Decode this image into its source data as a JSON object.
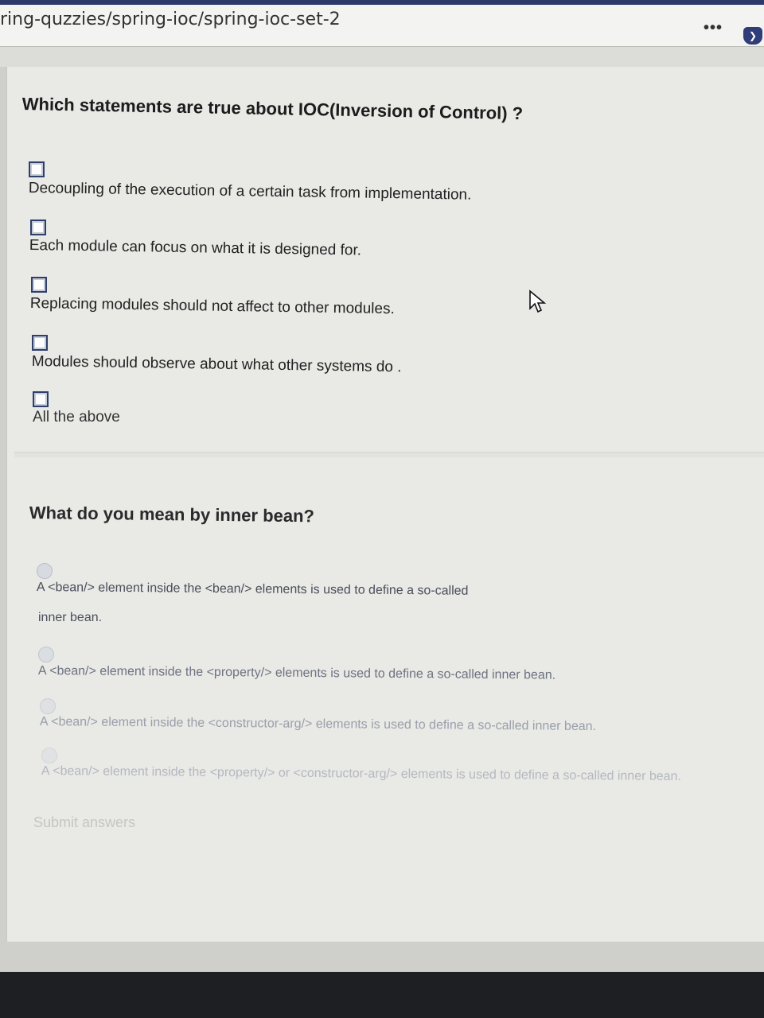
{
  "browser": {
    "url": "ring-quzzies/spring-ioc/spring-ioc-set-2",
    "more_icon": "more-dots-icon",
    "pocket_icon": "pocket-icon"
  },
  "question1": {
    "title": "Which statements are true about IOC(Inversion of Control) ?",
    "options": [
      "Decoupling of the execution of a certain task from implementation.",
      "Each module can focus on what it is designed for.",
      "Replacing modules should not affect to other modules.",
      "Modules should observe about what other systems do .",
      "All the above"
    ]
  },
  "question2": {
    "title": "What do you mean by inner bean?",
    "options": [
      {
        "line1": "A <bean/> element inside the <bean/> elements is used to define a so-called",
        "line2": "inner bean."
      },
      {
        "line1": "A <bean/> element inside the <property/> elements is used to define a so-called inner bean."
      },
      {
        "line1": "A <bean/> element inside the <constructor-arg/> elements is used to define a so-called inner bean."
      },
      {
        "line1": "A <bean/> element inside the <property/> or <constructor-arg/> elements is used to define a so-called inner bean."
      }
    ]
  },
  "submit_label": "Submit answers"
}
